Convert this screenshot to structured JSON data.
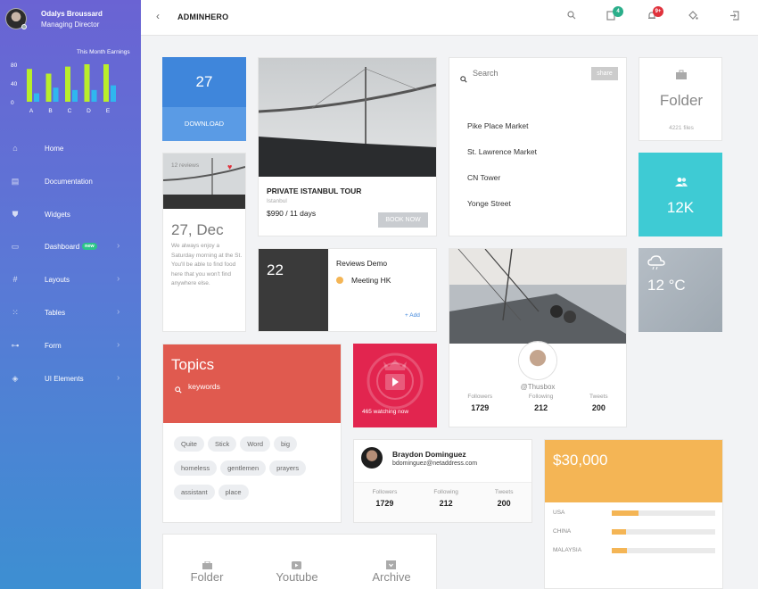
{
  "profile": {
    "name": "Odalys Broussard",
    "role": "Managing Director"
  },
  "earnings": {
    "title": "This Month Earnings",
    "yticks": [
      "80",
      "40",
      "0"
    ],
    "chart_data": {
      "type": "bar",
      "categories": [
        "A",
        "B",
        "C",
        "D",
        "E"
      ],
      "series": [
        {
          "values": [
            70,
            60,
            75,
            80,
            80
          ],
          "color": "#b9ee2a"
        },
        {
          "values": [
            18,
            30,
            25,
            25,
            35
          ],
          "color": "#2fb7ef"
        }
      ],
      "ylim": [
        0,
        80
      ]
    }
  },
  "nav": [
    {
      "label": "Home",
      "icon": "home-icon",
      "glyph": "⌂"
    },
    {
      "label": "Documentation",
      "icon": "document-icon",
      "glyph": "▤"
    },
    {
      "label": "Widgets",
      "icon": "widgets-icon",
      "glyph": "⛊"
    },
    {
      "label": "Dashboard",
      "icon": "monitor-icon",
      "glyph": "▭",
      "badge": "new",
      "chevron": "›"
    },
    {
      "label": "Layouts",
      "icon": "hash-icon",
      "glyph": "#",
      "chevron": "›"
    },
    {
      "label": "Tables",
      "icon": "grid-icon",
      "glyph": "⁙",
      "chevron": "›"
    },
    {
      "label": "Form",
      "icon": "toggle-icon",
      "glyph": "⊶",
      "chevron": "›"
    },
    {
      "label": "UI Elements",
      "icon": "cube-icon",
      "glyph": "◈",
      "chevron": "›"
    }
  ],
  "topbar": {
    "back": "‹",
    "brand": "ADMINHERO",
    "notif1": "4",
    "notif2": "9+"
  },
  "download": {
    "number": "27",
    "label": "DOWNLOAD"
  },
  "tour": {
    "title": "PRIVATE ISTANBUL TOUR",
    "location": "Istanbul",
    "price": "$990 / 11 days",
    "button": "BOOK NOW"
  },
  "search": {
    "placeholder": "Search",
    "share": "share",
    "items": [
      "Pike Place Market",
      "St. Lawrence Market",
      "CN Tower",
      "Yonge Street"
    ]
  },
  "folder": {
    "title": "Folder",
    "count": "4221 files"
  },
  "users": {
    "value": "12K"
  },
  "review": {
    "count": "12 reviews",
    "date": "27, Dec",
    "text": "We always enjoy a Saturday morning at the St. You'll be able to find food here that you won't find anywhere else."
  },
  "calendar": {
    "day": "22",
    "title": "Reviews Demo",
    "event": "Meeting HK",
    "add": "+ Add"
  },
  "boat": {
    "handle": "@Thusbox",
    "stats": [
      {
        "k": "Followers",
        "v": "1729"
      },
      {
        "k": "Following",
        "v": "212"
      },
      {
        "k": "Tweets",
        "v": "200"
      }
    ]
  },
  "weather": {
    "temp": "12 °C"
  },
  "topics": {
    "title": "Topics",
    "search": "keywords",
    "tags": [
      "Quite",
      "Stick",
      "Word",
      "big",
      "homeless",
      "gentlemen",
      "prayers",
      "assistant",
      "place"
    ]
  },
  "video": {
    "watching": "465 watching now"
  },
  "contact": {
    "name": "Braydon Dominguez",
    "email": "bdominguez@netaddress.com",
    "stats": [
      {
        "k": "Followers",
        "v": "1729"
      },
      {
        "k": "Following",
        "v": "212"
      },
      {
        "k": "Tweets",
        "v": "200"
      }
    ]
  },
  "money": {
    "value": "$30,000",
    "rows": [
      {
        "label": "USA",
        "pct": 26
      },
      {
        "label": "CHINA",
        "pct": 14
      },
      {
        "label": "MALAYSIA",
        "pct": 15
      }
    ]
  },
  "bottom": {
    "items": [
      {
        "label": "Folder",
        "icon": "folder-icon"
      },
      {
        "label": "Youtube",
        "icon": "youtube-icon"
      },
      {
        "label": "Archive",
        "icon": "archive-icon"
      }
    ]
  }
}
